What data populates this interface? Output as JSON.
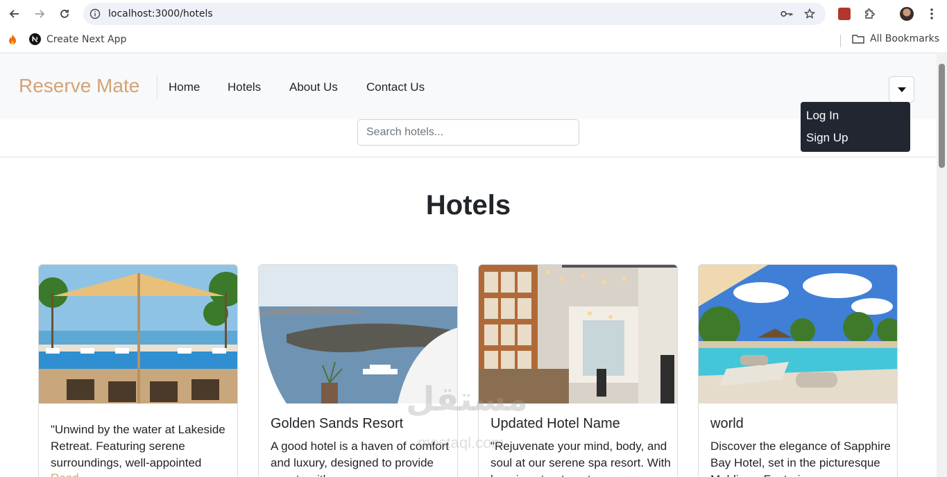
{
  "browser": {
    "url": "localhost:3000/hotels",
    "bookmarks": [
      "Create Next App"
    ],
    "all_bookmarks_label": "All Bookmarks"
  },
  "navbar": {
    "brand": "Reserve Mate",
    "links": [
      "Home",
      "Hotels",
      "About Us",
      "Contact Us"
    ],
    "dropdown_items": [
      "Log In",
      "Sign Up"
    ]
  },
  "search": {
    "placeholder": "Search hotels..."
  },
  "page": {
    "title": "Hotels"
  },
  "hotels": [
    {
      "name": "",
      "description": "\"Unwind by the water at Lakeside Retreat. Featuring serene surroundings, well-appointed",
      "read_more": "Read"
    },
    {
      "name": "Golden Sands Resort",
      "description": "A good hotel is a haven of comfort and luxury, designed to provide guests with an"
    },
    {
      "name": "Updated Hotel Name",
      "description": "\"Rejuvenate your mind, body, and soul at our serene spa resort. With luxurious treatments"
    },
    {
      "name": "world",
      "description": "Discover the elegance of Sapphire Bay Hotel, set in the picturesque Maldives. Featuring"
    }
  ],
  "watermark": {
    "main": "مستقل",
    "sub": "mostaql.com"
  },
  "colors": {
    "brand": "#d4a373",
    "dropdown_bg": "#212631",
    "navbar_bg": "#f8f9fa"
  }
}
